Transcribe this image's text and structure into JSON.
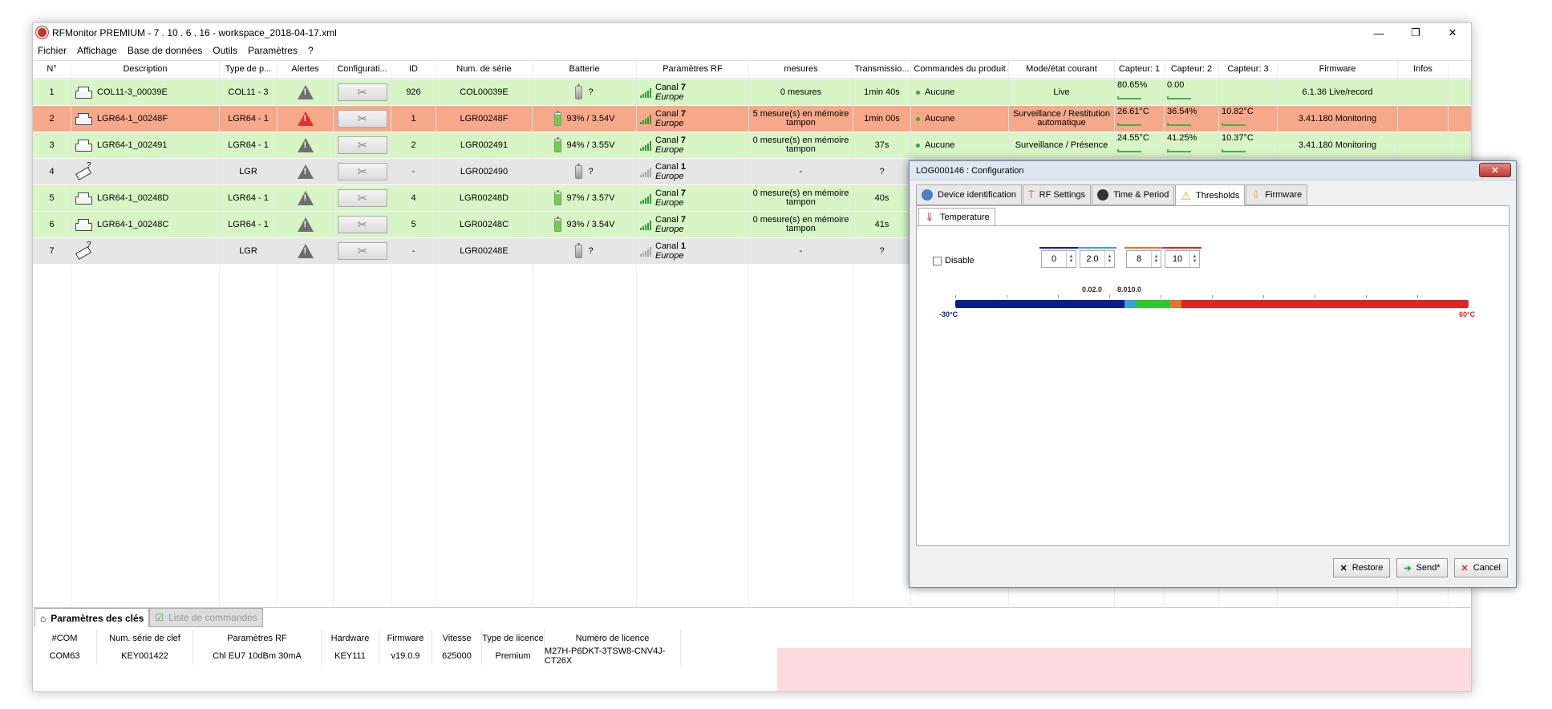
{
  "window": {
    "title": "RFMonitor PREMIUM - 7 . 10 . 6 . 16 - workspace_2018-04-17.xml",
    "controls": {
      "minimize": "—",
      "restore": "❐",
      "close": "✕"
    }
  },
  "menu": [
    "Fichier",
    "Affichage",
    "Base de données",
    "Outils",
    "Paramètres",
    "?"
  ],
  "grid": {
    "columns": [
      "N°",
      "Description",
      "Type de p...",
      "Alertes",
      "Configurati...",
      "ID",
      "Num. de série",
      "Batterie",
      "Paramètres RF",
      "mesures",
      "Transmissio...",
      "Commandes du produit",
      "Mode/état courant",
      "Capteur: 1",
      "Capteur: 2",
      "Capteur: 3",
      "Firmware",
      "Infos"
    ],
    "rows": [
      {
        "n": "1",
        "desc": "COL11-3_00039E",
        "type": "COL11 - 3",
        "alert": "grey",
        "id": "926",
        "serial": "COL00039E",
        "batt": "?",
        "canal": "Canal",
        "canal_num": "7",
        "region": "Europe",
        "mesures": "0 mesures",
        "trans": "1min 40s",
        "cmd": "Aucune",
        "mode": "Live",
        "s1": "80.65%",
        "s2": "0.00",
        "s3": "",
        "fw": "6.1.36 Live/record",
        "style": "green"
      },
      {
        "n": "2",
        "desc": "LGR64-1_00248F",
        "type": "LGR64 - 1",
        "alert": "red",
        "id": "1",
        "serial": "LGR00248F",
        "batt": "93% / 3.54V",
        "canal": "Canal",
        "canal_num": "7",
        "region": "Europe",
        "mesures": "5 mesure(s) en mémoire tampon",
        "trans": "1min 00s",
        "cmd": "Aucune",
        "mode": "Surveillance / Restitution automatique",
        "s1": "26.61°C",
        "s2": "36.54%",
        "s3": "10.82°C",
        "fw": "3.41.180 Monitoring",
        "style": "orange"
      },
      {
        "n": "3",
        "desc": "LGR64-1_002491",
        "type": "LGR64 - 1",
        "alert": "grey",
        "id": "2",
        "serial": "LGR002491",
        "batt": "94% / 3.55V",
        "canal": "Canal",
        "canal_num": "7",
        "region": "Europe",
        "mesures": "0 mesure(s) en mémoire tampon",
        "trans": "37s",
        "cmd": "Aucune",
        "mode": "Surveillance / Présence",
        "s1": "24.55°C",
        "s2": "41.25%",
        "s3": "10.37°C",
        "fw": "3.41.180 Monitoring",
        "style": "green"
      },
      {
        "n": "4",
        "desc": "",
        "type": "LGR",
        "alert": "grey",
        "id": "-",
        "serial": "LGR002490",
        "batt": "?",
        "canal": "Canal",
        "canal_num": "1",
        "region": "Europe",
        "mesures": "-",
        "trans": "?",
        "cmd": "",
        "mode": "",
        "s1": "",
        "s2": "",
        "s3": "",
        "fw": "",
        "style": "grey"
      },
      {
        "n": "5",
        "desc": "LGR64-1_00248D",
        "type": "LGR64 - 1",
        "alert": "grey",
        "id": "4",
        "serial": "LGR00248D",
        "batt": "97% / 3.57V",
        "canal": "Canal",
        "canal_num": "7",
        "region": "Europe",
        "mesures": "0 mesure(s) en mémoire tampon",
        "trans": "40s",
        "cmd": "",
        "mode": "",
        "s1": "",
        "s2": "",
        "s3": "",
        "fw": "",
        "style": "green"
      },
      {
        "n": "6",
        "desc": "LGR64-1_00248C",
        "type": "LGR64 - 1",
        "alert": "grey",
        "id": "5",
        "serial": "LGR00248C",
        "batt": "93% / 3.54V",
        "canal": "Canal",
        "canal_num": "7",
        "region": "Europe",
        "mesures": "0 mesure(s) en mémoire tampon",
        "trans": "41s",
        "cmd": "",
        "mode": "",
        "s1": "",
        "s2": "",
        "s3": "",
        "fw": "",
        "style": "green"
      },
      {
        "n": "7",
        "desc": "",
        "type": "LGR",
        "alert": "grey",
        "id": "-",
        "serial": "LGR00248E",
        "batt": "?",
        "canal": "Canal",
        "canal_num": "1",
        "region": "Europe",
        "mesures": "-",
        "trans": "?",
        "cmd": "",
        "mode": "",
        "s1": "",
        "s2": "",
        "s3": "",
        "fw": "",
        "style": "grey"
      }
    ]
  },
  "bottom": {
    "tabs": [
      "Paramètres des clés",
      "Liste de commandes"
    ],
    "columns": [
      "#COM",
      "Num. série de clef",
      "Paramètres RF",
      "Hardware",
      "Firmware",
      "Vitesse",
      "Type de licence",
      "Numéro de licence"
    ],
    "row": [
      "COM63",
      "KEY001422",
      "Chl EU7  10dBm 30mA",
      "KEY111",
      "v19.0.9",
      "625000",
      "Premium",
      "M27H-P6DKT-3TSW8-CNV4J-CT26X"
    ]
  },
  "dialog": {
    "title": "LOG000146 : Configuration",
    "close": "✕",
    "tabs": [
      "Device identification",
      "RF Settings",
      "Time & Period",
      "Thresholds",
      "Firmware"
    ],
    "subtab": "Temperature",
    "disable_label": "Disable",
    "thresholds": [
      "0",
      "2.0",
      "8",
      "10"
    ],
    "scale_min": "-30°C",
    "scale_max": "60°C",
    "marker_left": "0.02.0",
    "marker_right": "8.010.0",
    "buttons": [
      "Restore",
      "Send*",
      "Cancel"
    ]
  },
  "colors": {
    "row_green": "#d7f5c5",
    "row_orange": "#f6a88a",
    "row_grey": "#e6e6e6",
    "bar_blue": "#0a1f8f",
    "bar_red": "#e02424",
    "bar_green": "#2ec82e"
  }
}
